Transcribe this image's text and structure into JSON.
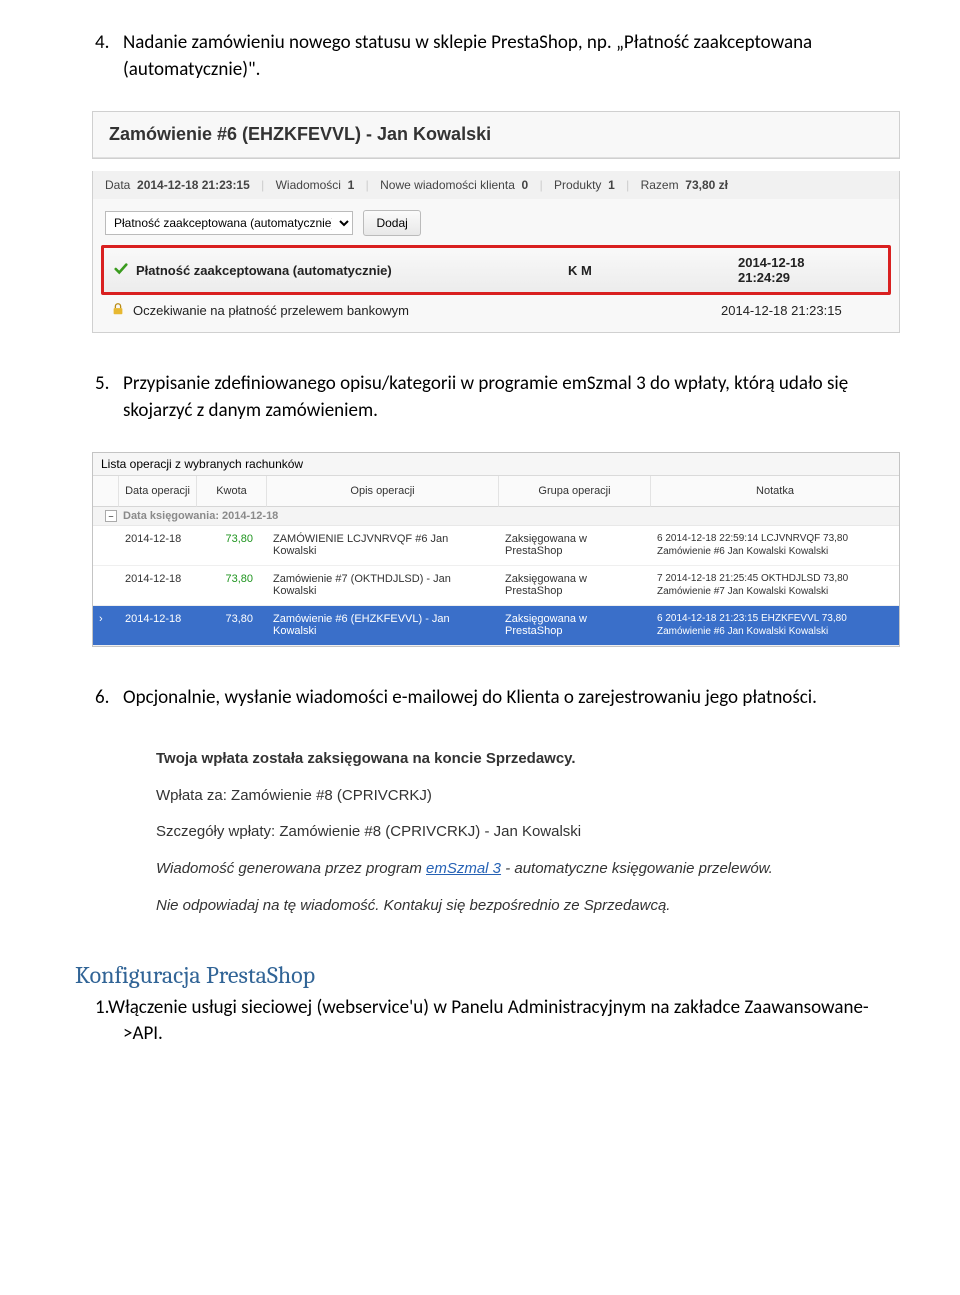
{
  "steps": {
    "s4_num": "4.",
    "s4_text": "Nadanie zamówieniu nowego statusu w sklepie PrestaShop, np. „Płatność zaakceptowana (automatycznie)\".",
    "s5_num": "5.",
    "s5_text": "Przypisanie zdefiniowanego opisu/kategorii  w programie emSzmal 3 do wpłaty, którą udało się skojarzyć z danym zamówieniem.",
    "s6_num": "6.",
    "s6_text": "Opcjonalnie, wysłanie wiadomości e-mailowej do Klienta o zarejestrowaniu jego płatności."
  },
  "order_panel": {
    "title": "Zamówienie #6 (EHZKFEVVL) - Jan Kowalski",
    "meta": {
      "label_data": "Data",
      "data": "2014-12-18 21:23:15",
      "label_msg": "Wiadomości",
      "msg": "1",
      "label_new": "Nowe wiadomości klienta",
      "new": "0",
      "label_prod": "Produkty",
      "prod": "1",
      "label_total": "Razem",
      "total": "73,80 zł"
    },
    "select": "Płatność zaakceptowana (automatycznie)",
    "add_btn": "Dodaj",
    "rows": [
      {
        "label": "Płatność zaakceptowana (automatycznie)",
        "who": "K M",
        "when1": "2014-12-18",
        "when2": "21:24:29"
      },
      {
        "label": "Oczekiwanie na płatność przelewem bankowym",
        "who": "",
        "when": "2014-12-18 21:23:15"
      }
    ]
  },
  "grid": {
    "title": "Lista operacji z wybranych rachunków",
    "headers": {
      "c1": "Data operacji",
      "c2": "Kwota",
      "c3": "Opis operacji",
      "c4": "Grupa operacji",
      "c5": "Notatka"
    },
    "group": "Data księgowania: 2014-12-18",
    "rows": [
      {
        "date": "2014-12-18",
        "amount": "73,80",
        "desc": "ZAMÓWIENIE LCJVNRVQF #6 Jan Kowalski",
        "group": "Zaksięgowana w PrestaShop",
        "note": "6 2014-12-18 22:59:14 LCJVNRVQF 73,80 Zamówienie #6 Jan Kowalski Kowalski"
      },
      {
        "date": "2014-12-18",
        "amount": "73,80",
        "desc": "Zamówienie #7 (OKTHDJLSD) - Jan Kowalski",
        "group": "Zaksięgowana w PrestaShop",
        "note": "7 2014-12-18 21:25:45 OKTHDJLSD 73,80 Zamówienie #7 Jan Kowalski Kowalski"
      },
      {
        "date": "2014-12-18",
        "amount": "73,80",
        "desc": "Zamówienie #6 (EHZKFEVVL) - Jan Kowalski",
        "group": "Zaksięgowana w PrestaShop",
        "note": "6 2014-12-18 21:23:15 EHZKFEVVL 73,80 Zamówienie #6 Jan Kowalski Kowalski"
      }
    ]
  },
  "email": {
    "l1": "Twoja wpłata została zaksięgowana na koncie Sprzedawcy.",
    "l2": "Wpłata za: Zamówienie #8 (CPRIVCRKJ)",
    "l3": "Szczegóły wpłaty: Zamówienie #8 (CPRIVCRKJ) - Jan Kowalski",
    "l4a": "Wiadomość generowana przez program ",
    "l4link": "emSzmal 3",
    "l4b": " - automatyczne księgowanie przelewów.",
    "l5": "Nie odpowiadaj na tę wiadomość. Kontakuj się bezpośrednio ze Sprzedawcą."
  },
  "section": {
    "heading": "Konfiguracja PrestaShop",
    "s1_num": "1.",
    "s1_text": "Włączenie usługi sieciowej (webservice'u) w Panelu Administracyjnym na zakładce Zaawansowane->API."
  }
}
